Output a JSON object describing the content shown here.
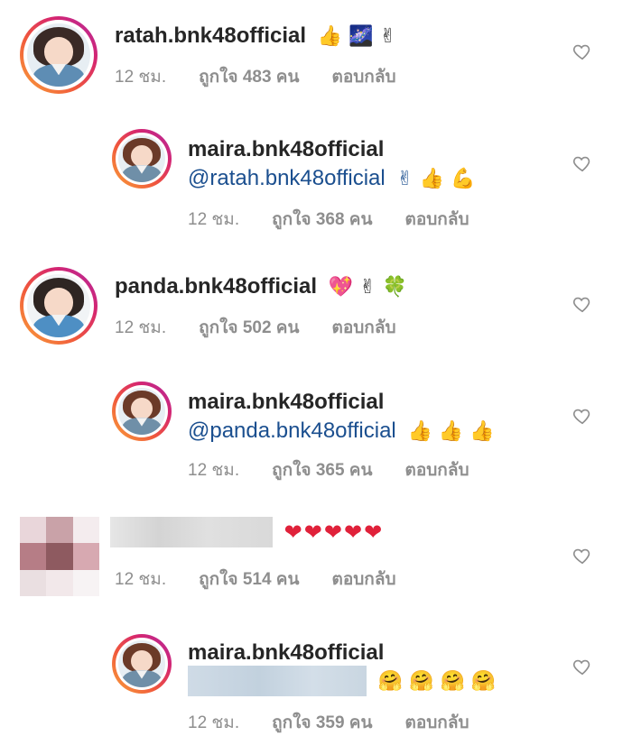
{
  "comments": [
    {
      "username": "ratah.bnk48official",
      "text_emoji": "👍 🌌 ✌",
      "time": "12 ชม.",
      "likes": "ถูกใจ 483 คน",
      "reply": "ตอบกลับ"
    },
    {
      "username": "maira.bnk48official",
      "mention": "@ratah.bnk48official",
      "text_emoji": "✌ 👍 💪",
      "time": "12 ชม.",
      "likes": "ถูกใจ 368 คน",
      "reply": "ตอบกลับ"
    },
    {
      "username": "panda.bnk48official",
      "text_emoji": "💖 ✌ 🍀",
      "time": "12 ชม.",
      "likes": "ถูกใจ 502 คน",
      "reply": "ตอบกลับ"
    },
    {
      "username": "maira.bnk48official",
      "mention": "@panda.bnk48official",
      "text_emoji": "👍 👍 👍",
      "time": "12 ชม.",
      "likes": "ถูกใจ 365 คน",
      "reply": "ตอบกลับ"
    },
    {
      "text_emoji": "❤❤❤❤❤",
      "time": "12 ชม.",
      "likes": "ถูกใจ 514 คน",
      "reply": "ตอบกลับ"
    },
    {
      "username": "maira.bnk48official",
      "text_emoji": "🤗 🤗 🤗 🤗",
      "time": "12 ชม.",
      "likes": "ถูกใจ 359 คน",
      "reply": "ตอบกลับ"
    }
  ],
  "colors": {
    "username": "#262626",
    "mention": "#1b4f8f",
    "meta": "#8e8e8e",
    "heart_red": "#e0213a",
    "ring_gradient": [
      "#f9a33a",
      "#d6266f",
      "#b12aa1"
    ]
  },
  "icons": {
    "like": "heart-outline-icon"
  }
}
